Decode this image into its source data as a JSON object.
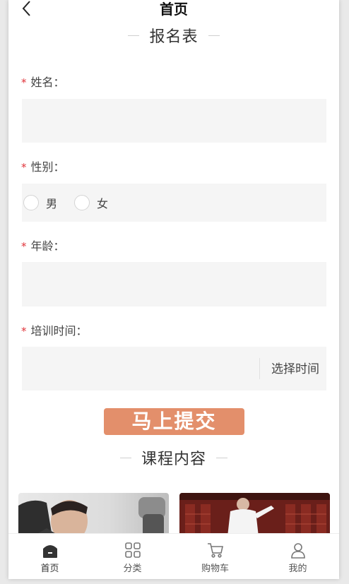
{
  "header": {
    "title": "首页"
  },
  "form": {
    "section_title": "报名表",
    "name": {
      "label": "姓名：",
      "required_mark": "*",
      "value": ""
    },
    "gender": {
      "label": "性别：",
      "required_mark": "*",
      "options": [
        "男",
        "女"
      ]
    },
    "age": {
      "label": "年龄：",
      "required_mark": "*",
      "value": ""
    },
    "training_time": {
      "label": "培训时间：",
      "required_mark": "*",
      "button_label": "选择时间"
    },
    "submit_label": "马上提交"
  },
  "courses": {
    "section_title": "课程内容"
  },
  "bottom_nav": {
    "items": [
      {
        "label": "首页",
        "icon": "home-icon",
        "active": true
      },
      {
        "label": "分类",
        "icon": "grid-icon",
        "active": false
      },
      {
        "label": "购物车",
        "icon": "cart-icon",
        "active": false
      },
      {
        "label": "我的",
        "icon": "user-icon",
        "active": false
      }
    ]
  },
  "colors": {
    "accent": "#e38f6b",
    "required": "#e0333a",
    "field_bg": "#f5f5f5"
  }
}
